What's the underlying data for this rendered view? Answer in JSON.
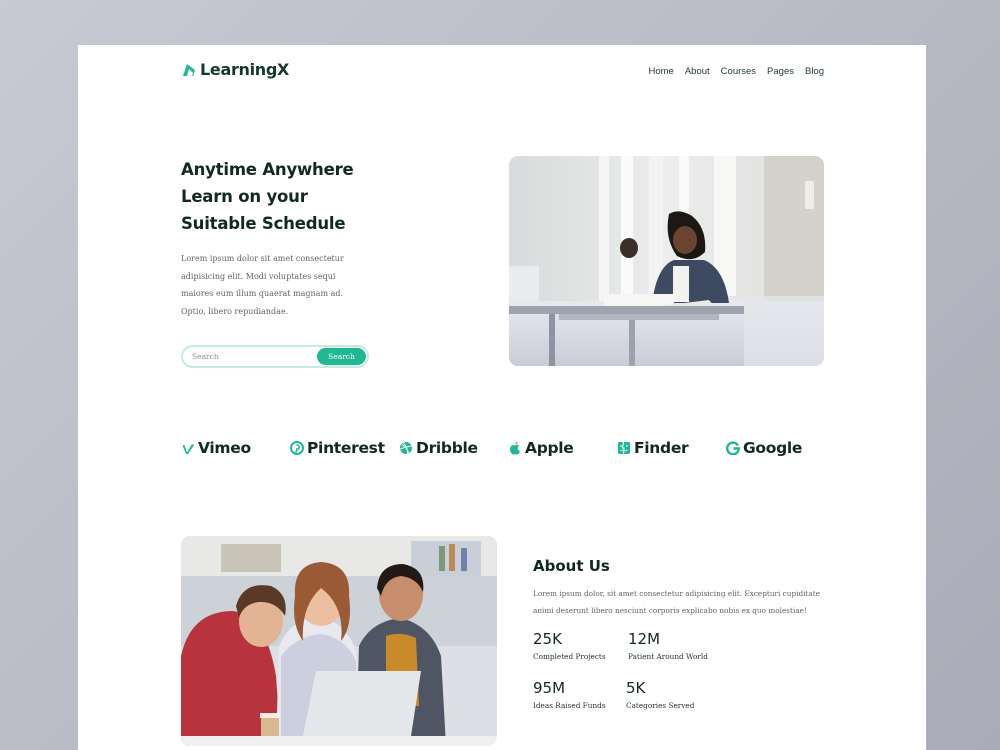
{
  "brand": {
    "name": "LearningX",
    "icon": "leaf-logo-icon",
    "accent": "#20b894"
  },
  "nav": {
    "items": [
      "Home",
      "About",
      "Courses",
      "Pages",
      "Blog"
    ]
  },
  "hero": {
    "title_lines": [
      "Anytime Anywhere",
      "Learn on your",
      "Suitable Schedule"
    ],
    "description_lines": [
      "Lorem ipsum dolor sit amet consectetur",
      "adipisicing elit. Modi voluptates sequi",
      "maiores eum illum quaerat magnam ad.",
      "Optio, libero repudiandae."
    ],
    "search": {
      "placeholder": "Search",
      "button_label": "Search"
    },
    "image": "student-studying-photo"
  },
  "brands": [
    {
      "name": "Vimeo",
      "icon": "vimeo-icon"
    },
    {
      "name": "Pinterest",
      "icon": "pinterest-icon"
    },
    {
      "name": "Dribble",
      "icon": "dribbble-icon"
    },
    {
      "name": "Apple",
      "icon": "apple-icon"
    },
    {
      "name": "Finder",
      "icon": "finder-icon"
    },
    {
      "name": "Google",
      "icon": "google-icon"
    }
  ],
  "about": {
    "title": "About Us",
    "description_lines": [
      "Lorem ipsum dolor, sit amet consectetur adipisicing elit. Excepturi cupiditate",
      "animi deserunt libero nesciunt corporis explicabo nobis ex quo molestiae!"
    ],
    "image": "students-laptop-photo",
    "stats": [
      {
        "value": "25K",
        "label": "Completed Projects"
      },
      {
        "value": "12M",
        "label": "Patient Around World"
      },
      {
        "value": "95M",
        "label": "Ideas Raised Funds"
      },
      {
        "value": "5K",
        "label": "Categories Served"
      }
    ]
  }
}
